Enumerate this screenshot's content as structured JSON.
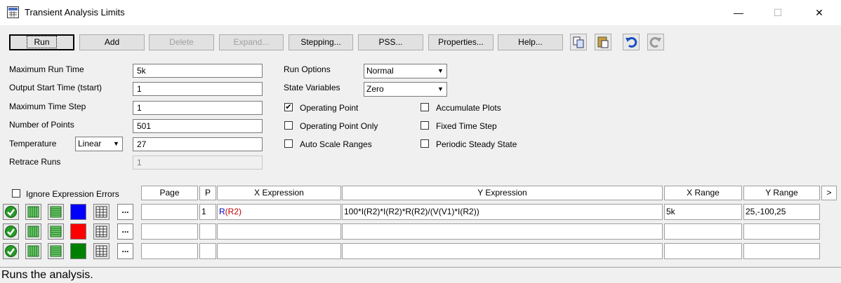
{
  "window": {
    "title": "Transient Analysis Limits",
    "minimize": "—",
    "maximize": "☐",
    "close": "✕"
  },
  "toolbar": {
    "run": "Run",
    "add": "Add",
    "delete": "Delete",
    "expand": "Expand...",
    "stepping": "Stepping...",
    "pss": "PSS...",
    "properties": "Properties...",
    "help": "Help..."
  },
  "fields": {
    "max_run_time_label": "Maximum Run Time",
    "max_run_time": "5k",
    "output_start_label": "Output Start Time (tstart)",
    "output_start": "1",
    "max_time_step_label": "Maximum Time Step",
    "max_time_step": "1",
    "num_points_label": "Number of Points",
    "num_points": "501",
    "temperature_label": "Temperature",
    "temperature_mode": "Linear",
    "temperature": "27",
    "retrace_label": "Retrace Runs",
    "retrace": "1"
  },
  "options": {
    "run_options_label": "Run Options",
    "run_options": "Normal",
    "state_vars_label": "State Variables",
    "state_vars": "Zero",
    "operating_point": "Operating Point",
    "operating_point_checked": true,
    "operating_point_only": "Operating Point Only",
    "auto_scale": "Auto Scale Ranges",
    "accumulate": "Accumulate Plots",
    "fixed_step": "Fixed Time Step",
    "periodic": "Periodic Steady State"
  },
  "grid": {
    "ignore_errors": "Ignore Expression Errors",
    "headers": {
      "page": "Page",
      "p": "P",
      "x": "X Expression",
      "y": "Y Expression",
      "xr": "X Range",
      "yr": "Y Range",
      "more": ">"
    },
    "rows": [
      {
        "color": "#0000ff",
        "page": "",
        "p": "1",
        "x_fn": "R",
        "x_arg": "(R2)",
        "y": "100*I(R2)*I(R2)*R(R2)/(V(V1)*I(R2))",
        "xr": "5k",
        "yr": "25,-100,25"
      },
      {
        "color": "#ff0000",
        "page": "",
        "p": "",
        "x_fn": "",
        "x_arg": "",
        "y": "",
        "xr": "",
        "yr": ""
      },
      {
        "color": "#008000",
        "page": "",
        "p": "",
        "x_fn": "",
        "x_arg": "",
        "y": "",
        "xr": "",
        "yr": ""
      }
    ],
    "dots": "..."
  },
  "status": "Runs the analysis."
}
